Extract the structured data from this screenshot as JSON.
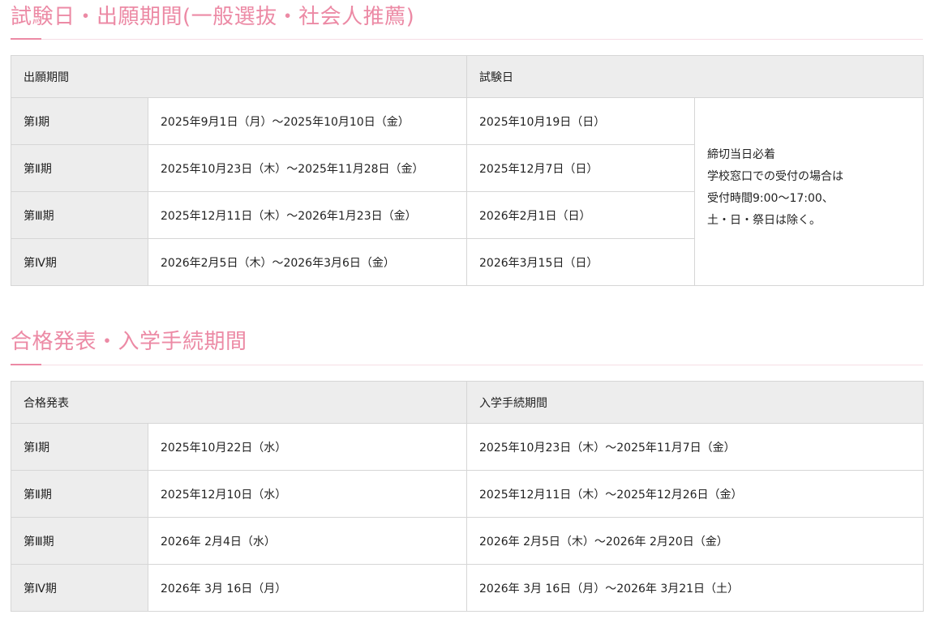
{
  "section1": {
    "title": "試験日・出願期間(一般選抜・社会人推薦)",
    "headers": {
      "application": "出願期間",
      "exam": "試験日"
    },
    "rows": [
      {
        "term": "第Ⅰ期",
        "application": "2025年9月1日（月）～2025年10月10日（金）",
        "exam": "2025年10月19日（日）"
      },
      {
        "term": "第Ⅱ期",
        "application": "2025年10月23日（木）～2025年11月28日（金）",
        "exam": "2025年12月7日（日）"
      },
      {
        "term": "第Ⅲ期",
        "application": "2025年12月11日（木）～2026年1月23日（金）",
        "exam": "2026年2月1日（日）"
      },
      {
        "term": "第Ⅳ期",
        "application": "2026年2月5日（木）～2026年3月6日（金）",
        "exam": "2026年3月15日（日）"
      }
    ],
    "note": [
      "締切当日必着",
      "学校窓口での受付の場合は",
      "受付時間9:00～17:00、",
      "土・日・祭日は除く。"
    ]
  },
  "section2": {
    "title": "合格発表・入学手続期間",
    "headers": {
      "announcement": "合格発表",
      "enrollment": "入学手続期間"
    },
    "rows": [
      {
        "term": "第Ⅰ期",
        "announcement": "2025年10月22日（水）",
        "enrollment": "2025年10月23日（木）～2025年11月7日（金）"
      },
      {
        "term": "第Ⅱ期",
        "announcement": "2025年12月10日（水）",
        "enrollment": "2025年12月11日（木）～2025年12月26日（金）"
      },
      {
        "term": "第Ⅲ期",
        "announcement": "2026年 2月4日（水）",
        "enrollment": "2026年 2月5日（木）～2026年 2月20日（金）"
      },
      {
        "term": "第Ⅳ期",
        "announcement": "2026年 3月 16日（月）",
        "enrollment": "2026年 3月 16日（月）～2026年 3月21日（土）"
      }
    ]
  },
  "colors": {
    "accent": "#ec8aa5",
    "header_bg": "#ededed",
    "border": "#d6d6d6"
  }
}
